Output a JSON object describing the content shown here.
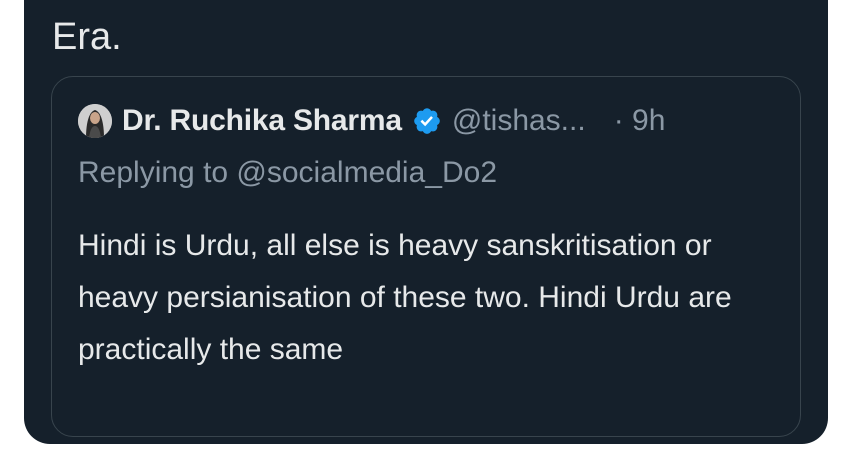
{
  "tweet": {
    "text_fragment": "Era."
  },
  "quoted_tweet": {
    "author_name": "Dr. Ruchika Sharma",
    "handle": "@tishas...",
    "timestamp": "· 9h",
    "replying_to": "Replying to @socialmedia_Do2",
    "body": "Hindi is Urdu, all else is heavy sanskritisation or heavy persianisation of these two. Hindi Urdu are practically the same",
    "avatar_icon": "profile-photo",
    "verified_icon": "verified-badge-icon"
  },
  "colors": {
    "card_background": "#15202b",
    "primary_text": "#e7e9ea",
    "secondary_text": "#8b98a5",
    "border": "#38444d",
    "verified_blue": "#1d9bf0",
    "page_background": "#ffffff"
  }
}
